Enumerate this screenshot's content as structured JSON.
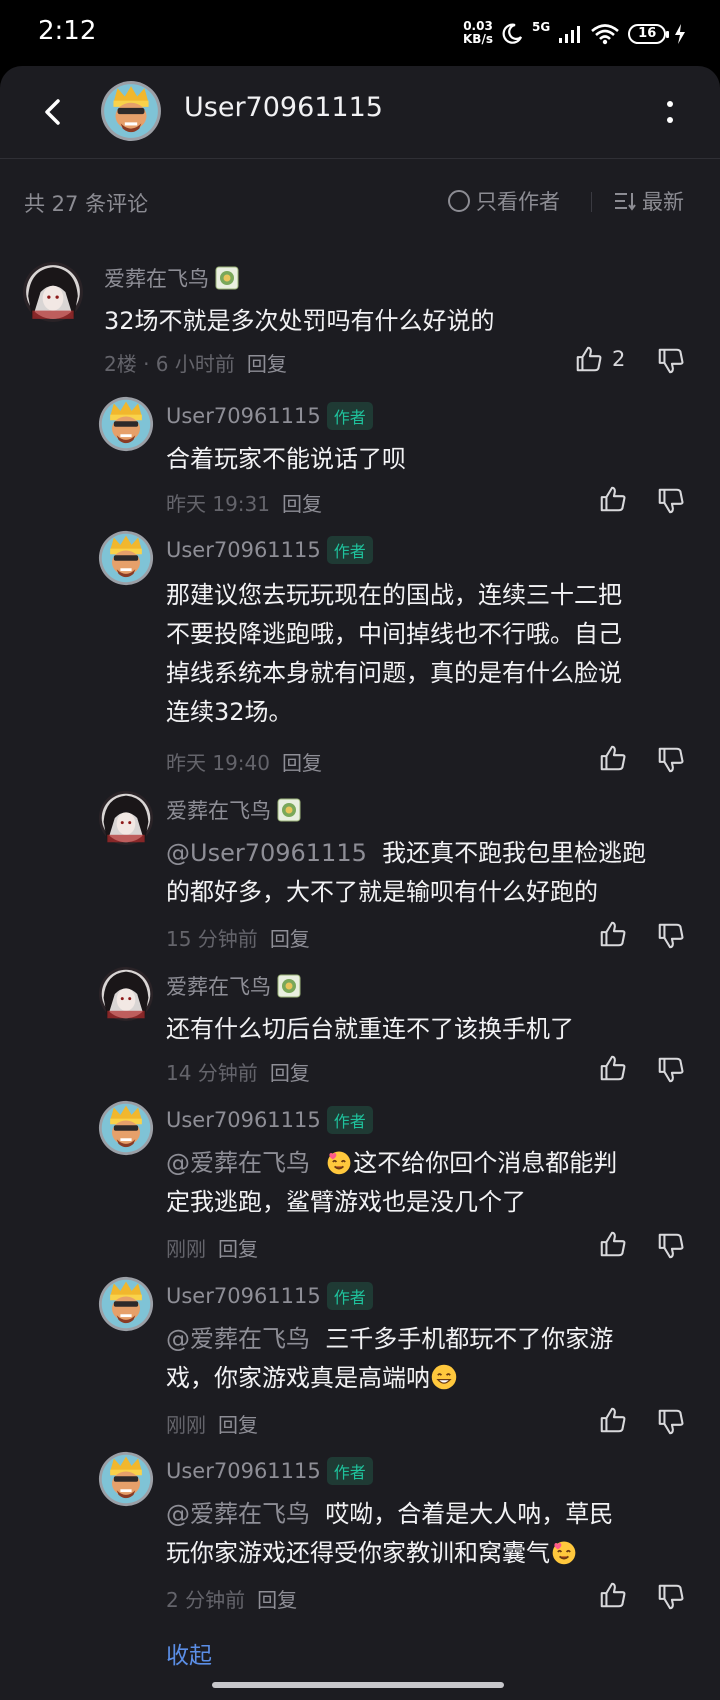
{
  "status": {
    "time": "2:12",
    "net_speed": "0.03",
    "net_unit": "KB/s",
    "net_type": "5G",
    "battery": "16"
  },
  "header": {
    "title": "User70961115"
  },
  "filter": {
    "count": "共 27 条评论",
    "author_only": "只看作者",
    "sort": "最新"
  },
  "comments": [
    {
      "name": "爱葬在飞鸟",
      "text": [
        "32场不就是多次处罚吗有什么好说的"
      ],
      "meta": "2楼 · 6 小时前",
      "reply": "回复",
      "likes": "2"
    },
    {
      "name": "User70961115",
      "badge": "作者",
      "text": [
        "合着玩家不能说话了呗"
      ],
      "meta": "昨天 19:31",
      "reply": "回复"
    },
    {
      "name": "User70961115",
      "badge": "作者",
      "text": [
        "那建议您去玩玩现在的国战，连续三十二把",
        "不要投降逃跑哦，中间掉线也不行哦。自己",
        "掉线系统本身就有问题，真的是有什么脸说",
        "连续32场。"
      ],
      "meta": "昨天 19:40",
      "reply": "回复"
    },
    {
      "name": "爱葬在飞鸟",
      "mention": "@User70961115",
      "text": [
        "我还真不跑我包里检逃跑",
        "的都好多，大不了就是输呗有什么好跑的"
      ],
      "meta": "15 分钟前",
      "reply": "回复"
    },
    {
      "name": "爱葬在飞鸟",
      "text": [
        "还有什么切后台就重连不了该换手机了"
      ],
      "meta": "14 分钟前",
      "reply": "回复"
    },
    {
      "name": "User70961115",
      "badge": "作者",
      "mention": "@爱葬在飞鸟",
      "text": [
        "这不给你回个消息都能判",
        "定我逃跑，鲨臂游戏也是没几个了"
      ],
      "meta": "刚刚",
      "reply": "回复"
    },
    {
      "name": "User70961115",
      "badge": "作者",
      "mention": "@爱葬在飞鸟",
      "text": [
        "三千多手机都玩不了你家游",
        "戏，你家游戏真是高端呐"
      ],
      "meta": "刚刚",
      "reply": "回复"
    },
    {
      "name": "User70961115",
      "badge": "作者",
      "mention": "@爱葬在飞鸟",
      "text": [
        "哎呦，合着是大人呐，草民",
        "玩你家游戏还得受你家教训和窝囊气"
      ],
      "meta": "2 分钟前",
      "reply": "回复"
    }
  ],
  "collapse": "收起",
  "icons": {
    "back": "back-arrow-icon",
    "more": "more-vertical-icon",
    "like": "thumbs-up-icon",
    "dislike": "thumbs-down-icon",
    "sort": "sort-list-icon"
  },
  "colors": {
    "background": "#1c1c21",
    "author_badge": "#1fc29c",
    "link": "#5b8ee6"
  }
}
